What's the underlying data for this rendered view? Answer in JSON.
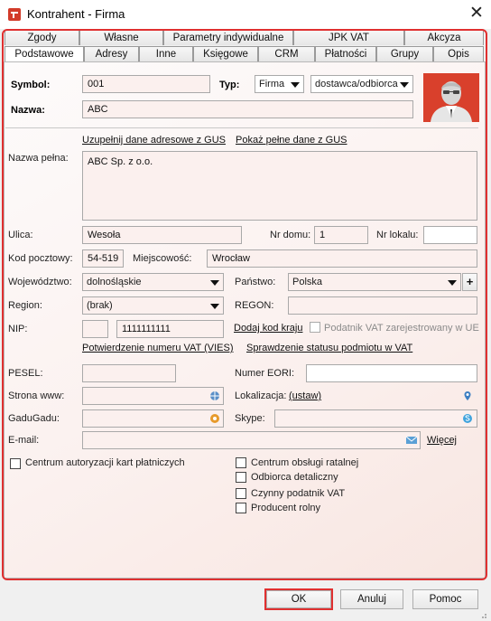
{
  "window": {
    "title": "Kontrahent - Firma",
    "close_glyph": "✕"
  },
  "tabs_row1": [
    "Zgody",
    "Własne",
    "Parametry indywidualne",
    "JPK VAT",
    "Akcyza"
  ],
  "tabs_row2": [
    "Podstawowe",
    "Adresy",
    "Inne",
    "Księgowe",
    "CRM",
    "Płatności",
    "Grupy",
    "Opis"
  ],
  "active_tab": "Podstawowe",
  "form": {
    "symbol_label": "Symbol:",
    "symbol_value": "001",
    "typ_label": "Typ:",
    "typ_value": "Firma",
    "typ_role_value": "dostawca/odbiorca",
    "nazwa_label": "Nazwa:",
    "nazwa_value": "ABC",
    "gus_fill_link": "Uzupełnij dane adresowe z GUS",
    "gus_show_link": "Pokaż pełne dane z GUS",
    "nazwa_pelna_label": "Nazwa pełna:",
    "nazwa_pelna_value": "ABC Sp. z o.o.",
    "ulica_label": "Ulica:",
    "ulica_value": "Wesoła",
    "nr_domu_label": "Nr domu:",
    "nr_domu_value": "1",
    "nr_lokalu_label": "Nr lokalu:",
    "nr_lokalu_value": "",
    "kod_label": "Kod pocztowy:",
    "kod_value": "54-519",
    "miejscowosc_label": "Miejscowość:",
    "miejscowosc_value": "Wrocław",
    "wojewodztwo_label": "Województwo:",
    "wojewodztwo_value": "dolnośląskie",
    "panstwo_label": "Państwo:",
    "panstwo_value": "Polska",
    "panstwo_add": "+",
    "region_label": "Region:",
    "region_value": "(brak)",
    "regon_label": "REGON:",
    "regon_value": "",
    "nip_label": "NIP:",
    "nip_prefix_value": "",
    "nip_value": "1111111111",
    "dodaj_kod_link": "Dodaj kod kraju",
    "vat_ue_label": "Podatnik VAT zarejestrowany w UE",
    "vies_link": "Potwierdzenie numeru VAT (VIES)",
    "status_link": "Sprawdzenie statusu podmiotu w VAT",
    "pesel_label": "PESEL:",
    "pesel_value": "",
    "eori_label": "Numer EORI:",
    "eori_value": "",
    "www_label": "Strona www:",
    "www_value": "",
    "lokalizacja_label": "Lokalizacja:",
    "lokalizacja_link": "(ustaw)",
    "gadu_label": "GaduGadu:",
    "gadu_value": "",
    "skype_label": "Skype:",
    "skype_value": "",
    "email_label": "E-mail:",
    "email_value": "",
    "wiecej_link": "Więcej",
    "chk_centrum_kart": "Centrum autoryzacji kart płatniczych",
    "chk_centrum_ratalnej": "Centrum obsługi ratalnej",
    "chk_odbiorca": "Odbiorca detaliczny",
    "chk_czynny_vat": "Czynny podatnik VAT",
    "chk_producent": "Producent rolny"
  },
  "buttons": {
    "ok": "OK",
    "anuluj": "Anuluj",
    "pomoc": "Pomoc"
  },
  "colors": {
    "highlight": "#e03030",
    "panel_tint": "#f8e6e1",
    "avatar_bg": "#d9402c"
  }
}
